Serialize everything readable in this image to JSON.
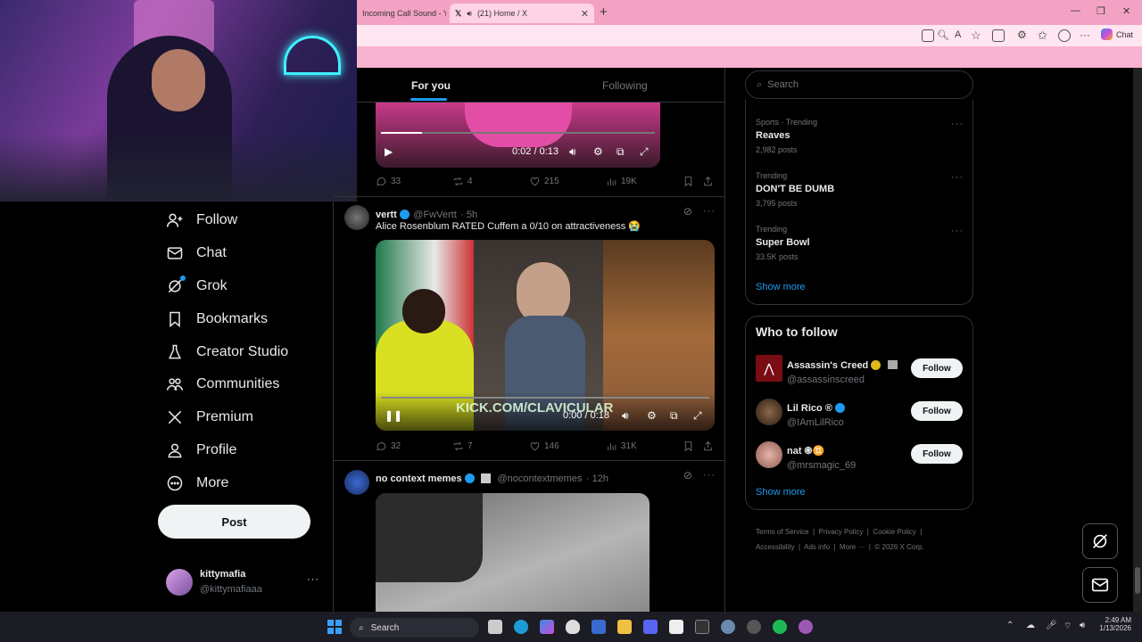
{
  "browser": {
    "tabs": [
      {
        "title": "Incoming Call Sound - Yo"
      },
      {
        "title": "(21) Home / X"
      }
    ],
    "chat_label": "Chat"
  },
  "nav": {
    "items": [
      {
        "label": "Follow",
        "icon": "person-plus-icon"
      },
      {
        "label": "Chat",
        "icon": "envelope-icon"
      },
      {
        "label": "Grok",
        "icon": "grok-icon"
      },
      {
        "label": "Bookmarks",
        "icon": "bookmark-icon"
      },
      {
        "label": "Creator Studio",
        "icon": "flask-icon"
      },
      {
        "label": "Communities",
        "icon": "people-icon"
      },
      {
        "label": "Premium",
        "icon": "x-logo-icon"
      },
      {
        "label": "Profile",
        "icon": "person-icon"
      },
      {
        "label": "More",
        "icon": "more-circle-icon"
      }
    ],
    "post_label": "Post",
    "account": {
      "name": "kittymafia",
      "handle": "@kittymafiaaa",
      "menu": "···"
    }
  },
  "feed": {
    "tabs": {
      "for_you": "For you",
      "following": "Following"
    },
    "first_video": {
      "time": "0:02 / 0:13",
      "progress": 0.15
    },
    "first_actions": {
      "replies": "33",
      "reposts": "4",
      "likes": "215",
      "views": "19K"
    },
    "tweet2": {
      "name": "vertt",
      "handle": "@FwVertt",
      "time": "· 5h",
      "text": "Alice Rosenblum RATED Cuffem a 0/10 on attractiveness 😭",
      "video_time": "0:00 / 0:18",
      "watermark": "KICK.COM/CLAVICULAR",
      "actions": {
        "replies": "32",
        "reposts": "7",
        "likes": "146",
        "views": "31K"
      }
    },
    "tweet3": {
      "name": "no context memes",
      "handle": "@nocontextmemes",
      "time": "· 12h"
    }
  },
  "sidebar": {
    "search_placeholder": "Search",
    "trends": [
      {
        "meta": "Sports · Trending",
        "name": "Reaves",
        "posts": "2,982 posts"
      },
      {
        "meta": "Trending",
        "name": "DON'T BE DUMB",
        "posts": "3,795 posts"
      },
      {
        "meta": "Trending",
        "name": "Super Bowl",
        "posts": "33.5K posts"
      }
    ],
    "show_more": "Show more",
    "who_to_follow": {
      "title": "Who to follow",
      "accounts": [
        {
          "name": "Assassin's Creed",
          "handle": "@assassinscreed",
          "button": "Follow"
        },
        {
          "name": "Lil Rico ®",
          "handle": "@IAmLilRico",
          "button": "Follow"
        },
        {
          "name": "nat ֍♊",
          "handle": "@mrsmagic_69",
          "button": "Follow"
        }
      ],
      "show_more": "Show more"
    },
    "footer": {
      "links": [
        "Terms of Service",
        "Privacy Policy",
        "Cookie Policy",
        "Accessibility",
        "Ads info",
        "More ···"
      ],
      "copyright": "© 2026 X Corp."
    }
  },
  "taskbar": {
    "search": "Search",
    "time": "2:49 AM",
    "date": "1/13/2026"
  }
}
